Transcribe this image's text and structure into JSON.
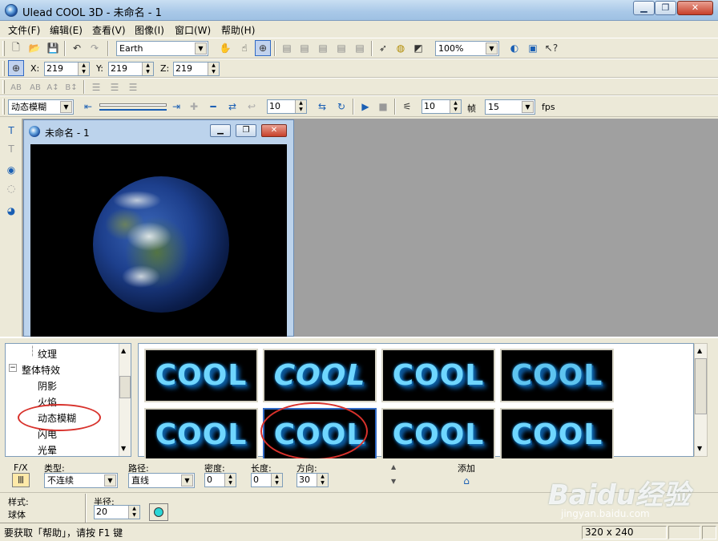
{
  "window": {
    "title": "Ulead COOL 3D - 未命名 - 1",
    "btn_min": "▁",
    "btn_max": "❐",
    "btn_close": "✕"
  },
  "menu": [
    "文件(F)",
    "编辑(E)",
    "查看(V)",
    "图像(I)",
    "窗口(W)",
    "帮助(H)"
  ],
  "toolbar1": {
    "object_combo": "Earth",
    "zoom_combo": "100%"
  },
  "toolbar2": {
    "x_label": "X:",
    "x_value": "219",
    "y_label": "Y:",
    "y_value": "219",
    "z_label": "Z:",
    "z_value": "219"
  },
  "toolbar3": {
    "icons": [
      "AB",
      "AB",
      "A↕",
      "B↕"
    ]
  },
  "toolbar4": {
    "effect_combo": "动态模糊",
    "frame_value": "10",
    "speed_value": "10",
    "frame_label": "帧",
    "fps_value": "15",
    "fps_label": "fps"
  },
  "document": {
    "title": "未命名 - 1",
    "btn_min": "▁",
    "btn_max": "❐",
    "btn_close": "✕"
  },
  "tree": {
    "items": [
      "纹理",
      "整体特效",
      "阴影",
      "火焰",
      "动态模糊",
      "闪电",
      "光晕"
    ],
    "expander": "−"
  },
  "thumbnails": {
    "label": "COOL",
    "count": 8
  },
  "properties": {
    "fx_label": "F/X",
    "type_label": "类型:",
    "type_value": "不连续",
    "path_label": "路径:",
    "path_value": "直线",
    "density_label": "密度:",
    "density_value": "0",
    "length_label": "长度:",
    "length_value": "0",
    "direction_label": "方向:",
    "direction_value": "30",
    "add_label": "添加",
    "style_label": "样式:",
    "style_value": "球体",
    "radius_label": "半径:",
    "radius_value": "20"
  },
  "status": {
    "help_text": "要获取「帮助」，请按 F1 键",
    "size": "320 x 240"
  },
  "watermark": {
    "logo": "Baidu经验",
    "url": "jingyan.baidu.com"
  }
}
